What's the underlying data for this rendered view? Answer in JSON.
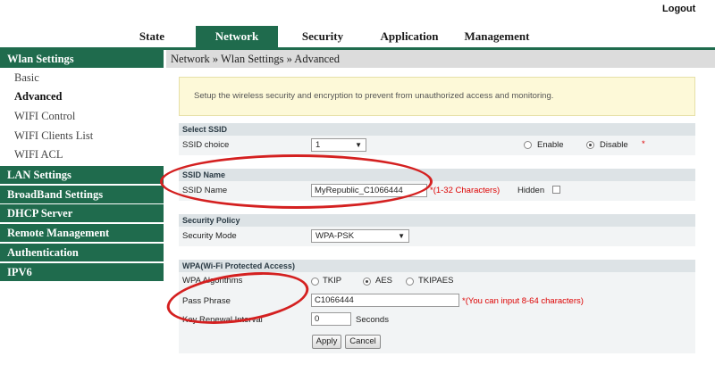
{
  "header": {
    "logout": "Logout"
  },
  "nav": {
    "tabs": [
      "State",
      "Network",
      "Security",
      "Application",
      "Management"
    ],
    "active": "Network"
  },
  "sidebar": {
    "sections": [
      {
        "label": "Wlan Settings",
        "items": [
          "Basic",
          "Advanced",
          "WIFI Control",
          "WIFI Clients List",
          "WIFI ACL"
        ]
      },
      {
        "label": "LAN Settings"
      },
      {
        "label": "BroadBand Settings"
      },
      {
        "label": "DHCP Server"
      },
      {
        "label": "Remote Management"
      },
      {
        "label": "Authentication"
      },
      {
        "label": "IPV6"
      }
    ],
    "active_item": "Advanced"
  },
  "breadcrumb": "Network » Wlan Settings » Advanced",
  "info": "Setup the wireless security and encryption to prevent from unauthorized access and monitoring.",
  "select_ssid": {
    "title": "Select SSID",
    "label": "SSID choice",
    "value": "1",
    "enable_label": "Enable",
    "disable_label": "Disable",
    "selected": "Disable",
    "required_mark": "*"
  },
  "ssid_name": {
    "title": "SSID Name",
    "label": "SSID Name",
    "value": "MyRepublic_C1066444",
    "hint": "*(1-32 Characters)",
    "hidden_label": "Hidden",
    "hidden_checked": false
  },
  "security_policy": {
    "title": "Security Policy",
    "label": "Security Mode",
    "value": "WPA-PSK"
  },
  "wpa": {
    "title": "WPA(Wi-Fi Protected Access)",
    "algorithms_label": "WPA Algorithms",
    "algorithms": [
      "TKIP",
      "AES",
      "TKIPAES"
    ],
    "algorithm_selected": "AES",
    "pass_label": "Pass Phrase",
    "pass_value": "C1066444",
    "pass_hint": "*(You can input 8-64 characters)",
    "renewal_label": "Key Renewal Interval",
    "renewal_value": "0",
    "renewal_unit": "Seconds"
  },
  "buttons": {
    "apply": "Apply",
    "cancel": "Cancel"
  },
  "icons": {
    "dropdown": "chevron-down-icon"
  },
  "colors": {
    "nav_green": "#1f6b4d",
    "annotation_red": "#d42020",
    "info_bg": "#fdf9d8"
  }
}
